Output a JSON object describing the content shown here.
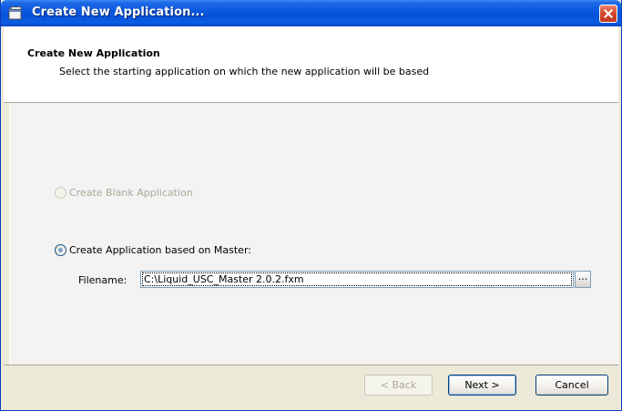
{
  "window": {
    "title": "Create New Application...",
    "icon": "application-window-icon"
  },
  "header": {
    "title": "Create New Application",
    "subtitle": "Select the starting application on which the new application will be based"
  },
  "options": {
    "blank": {
      "label": "Create Blank Application",
      "selected": false,
      "enabled": false
    },
    "master": {
      "label": "Create Application based on Master:",
      "selected": true,
      "enabled": true
    }
  },
  "filename": {
    "label": "Filename:",
    "value": "C:\\Liquid_USC_Master 2.0.2.fxm",
    "browse_label": "..."
  },
  "buttons": {
    "back": "< Back",
    "next": "Next >",
    "cancel": "Cancel"
  }
}
